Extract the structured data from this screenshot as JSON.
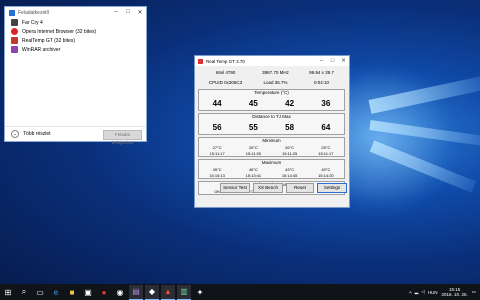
{
  "desktop": {
    "icons": [
      "",
      ""
    ]
  },
  "task_manager": {
    "title": "Feladatkezelő",
    "apps": [
      {
        "label": "Far Cry 4",
        "color": "#444444"
      },
      {
        "label": "Opera Internet Browser (32 bites)",
        "color": "#d9262e"
      },
      {
        "label": "RealTemp GT (32 bites)",
        "color": "#c0392b"
      },
      {
        "label": "WinRAR archiver",
        "color": "#8e44ad"
      }
    ],
    "more_details": "Több részlet",
    "end_task": "Feladat befejezése"
  },
  "realtemp": {
    "title": "Real Temp GT 3.70",
    "cpu": "Intel 4790",
    "mhz": "3967.70 MHz",
    "ratio": "99.94 x 39.7",
    "cpuid": "CPUID 0x306C3",
    "load": "Load 35.7%",
    "time": "0:04:10",
    "temperature_label": "Temperature (°C)",
    "temperatures": [
      "44",
      "45",
      "42",
      "36"
    ],
    "distance_label": "Distance to TJ Max",
    "distances": [
      "56",
      "55",
      "58",
      "64"
    ],
    "minimum_label": "Minimum",
    "minimum_temps": [
      "27°C",
      "25°C",
      "26°C",
      "25°C"
    ],
    "minimum_times": [
      "15:11:17",
      "15:11:30",
      "15:11:25",
      "15:11:17"
    ],
    "maximum_label": "Maximum",
    "maximum_temps": [
      "45°C",
      "46°C",
      "43°C",
      "40°C"
    ],
    "maximum_times": [
      "15:15:13",
      "15:13:41",
      "15:14:45",
      "15:14:20"
    ],
    "thermal_label": "Thermal Status",
    "thermal": [
      "OK",
      "OK",
      "OK",
      "OK"
    ],
    "buttons": {
      "sensor_test": "Sensor Test",
      "xs_bench": "XS Bench",
      "reset": "Reset",
      "settings": "Settings"
    }
  },
  "taskbar": {
    "icons": [
      "windows-icon",
      "search-icon",
      "task-view-icon",
      "edge-icon",
      "explorer-icon",
      "store-icon",
      "opera-icon",
      "steam-icon",
      "winrar-icon",
      "farcry-icon",
      "realtemp-icon",
      "taskmgr-icon",
      "games-icon"
    ],
    "clock_time": "15:15",
    "clock_date": "2016. 10. 25.",
    "lang": "HUN"
  }
}
